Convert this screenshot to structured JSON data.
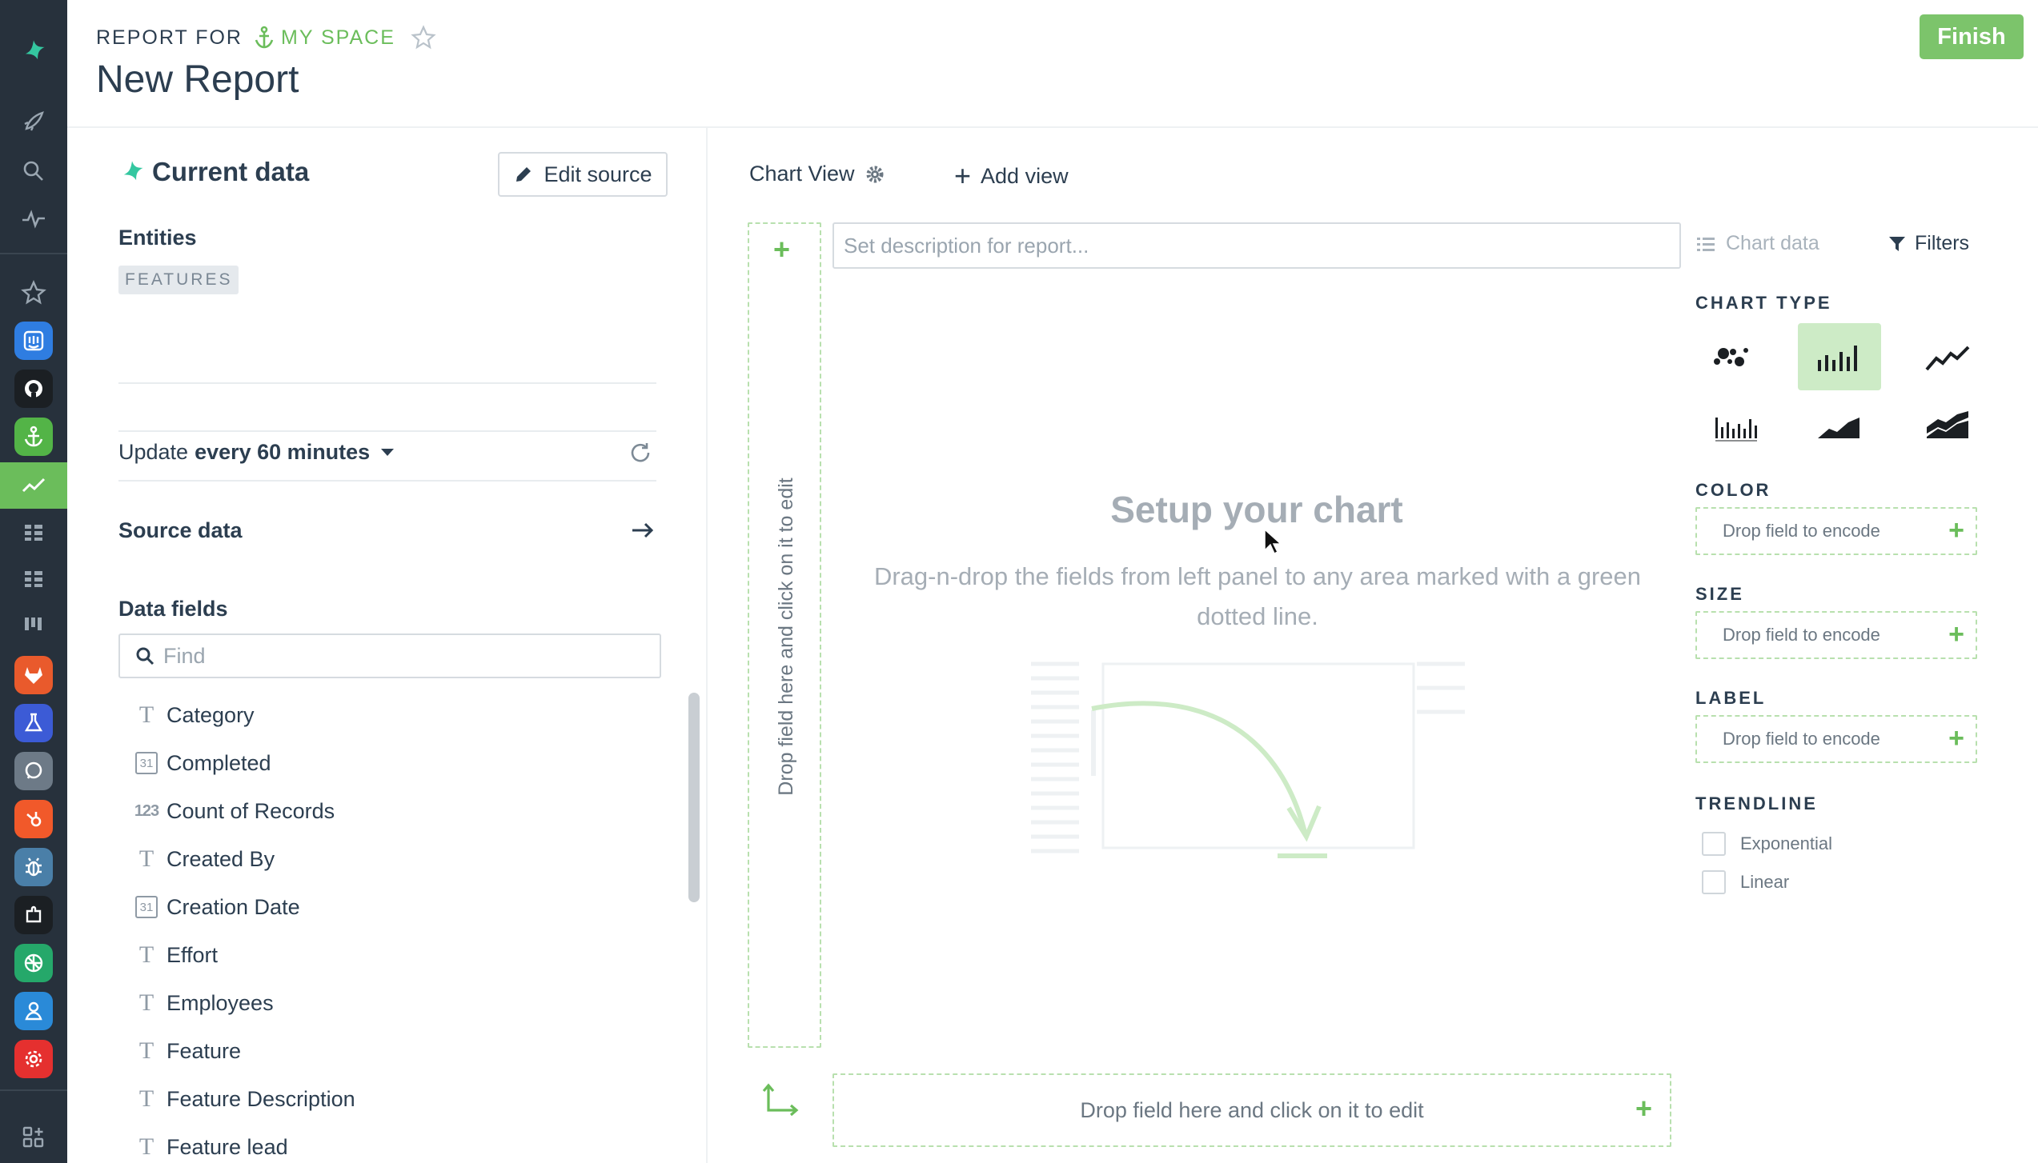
{
  "header": {
    "report_for": "REPORT FOR",
    "space_name": "MY SPACE",
    "title": "New Report",
    "finish_label": "Finish"
  },
  "rail": {
    "icons": [
      "logo-icon",
      "rocket-icon",
      "search-icon",
      "activity-icon",
      "star-icon",
      "intercom-app-icon",
      "github-app-icon",
      "anchor-app-icon",
      "chart-app-icon",
      "grid-app-icon",
      "grid-app-icon",
      "trello-app-icon",
      "gitlab-app-icon",
      "flask-app-icon",
      "chat-app-icon",
      "hubspot-app-icon",
      "bug-app-icon",
      "plugin-app-icon",
      "brain-app-icon",
      "person-app-icon",
      "gear-app-icon",
      "add-app-icon"
    ],
    "accent": "#6bbd5b",
    "background": "#27313c"
  },
  "left_panel": {
    "title": "Current data",
    "edit_source_label": "Edit source",
    "entities_heading": "Entities",
    "entity_tag": "FEATURES",
    "update_prefix": "Update",
    "update_value": "every 60 minutes",
    "source_data_label": "Source data",
    "data_fields_heading": "Data fields",
    "find_placeholder": "Find",
    "fields": [
      {
        "type": "text",
        "label": "Category"
      },
      {
        "type": "date",
        "label": "Completed"
      },
      {
        "type": "number",
        "label": "Count of Records"
      },
      {
        "type": "text",
        "label": "Created By"
      },
      {
        "type": "date",
        "label": "Creation Date"
      },
      {
        "type": "text",
        "label": "Effort"
      },
      {
        "type": "text",
        "label": "Employees"
      },
      {
        "type": "text",
        "label": "Feature"
      },
      {
        "type": "text",
        "label": "Feature Description"
      },
      {
        "type": "text",
        "label": "Feature lead"
      }
    ],
    "type_glyphs": {
      "text": "T",
      "date": "31",
      "number": "123"
    }
  },
  "main": {
    "tab_label": "Chart View",
    "add_view_label": "Add view",
    "description_placeholder": "Set description for report...",
    "y_drop_label": "Drop field here and click on it to edit",
    "x_drop_label": "Drop field here and click on it to edit",
    "setup_title": "Setup your chart",
    "setup_subtitle": "Drag-n-drop the fields from left panel to any area marked with a green dotted line."
  },
  "right_panel": {
    "chart_data_tab": "Chart data",
    "filters_tab": "Filters",
    "chart_type_heading": "CHART TYPE",
    "chart_types": [
      "scatter",
      "bar",
      "line",
      "histogram",
      "area",
      "stacked-area"
    ],
    "selected_chart_type": "bar",
    "color_heading": "COLOR",
    "size_heading": "SIZE",
    "label_heading": "LABEL",
    "encode_placeholder": "Drop field to encode",
    "trendline_heading": "TRENDLINE",
    "trendlines": [
      "Exponential",
      "Linear"
    ]
  }
}
